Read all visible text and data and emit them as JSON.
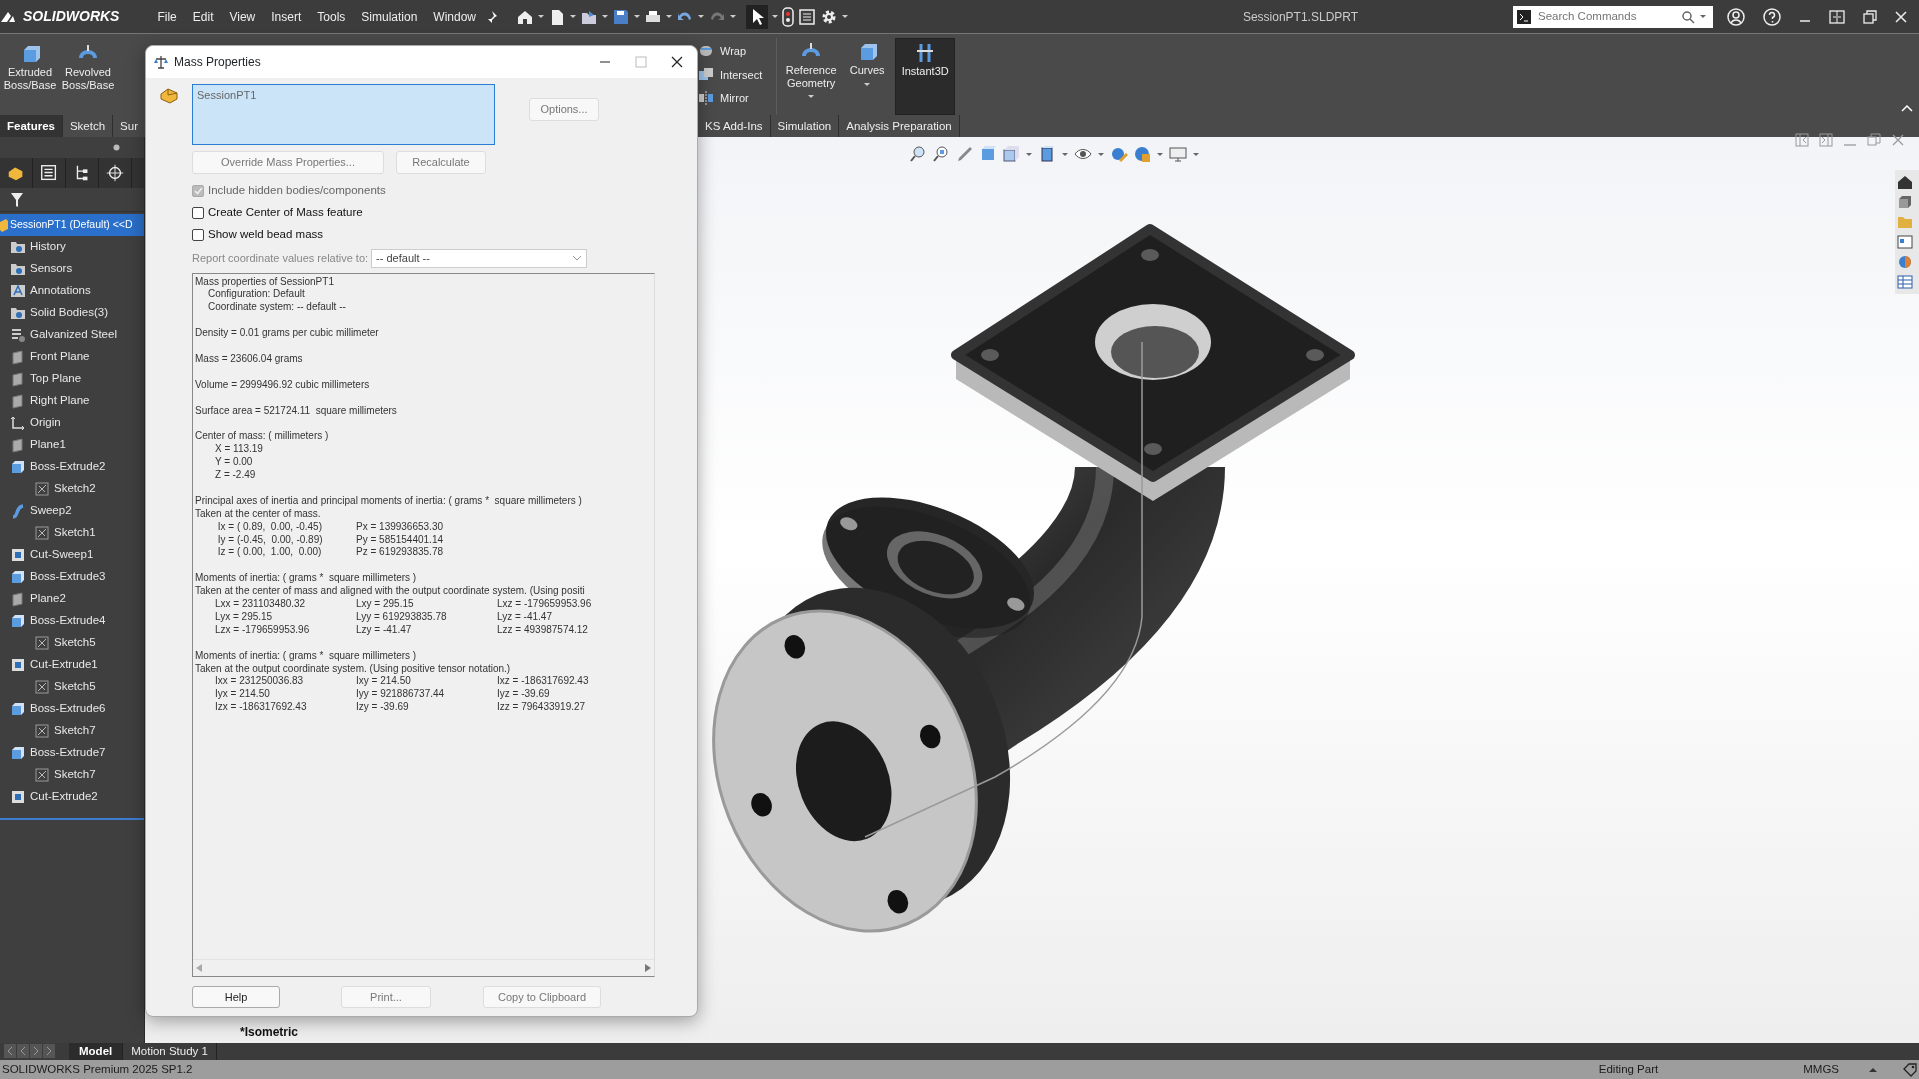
{
  "app": {
    "logo": "SOLIDWORKS",
    "menu": [
      "File",
      "Edit",
      "View",
      "Insert",
      "Tools",
      "Simulation",
      "Window"
    ],
    "document_title": "SessionPT1.SLDPRT",
    "search": {
      "placeholder": "Search Commands"
    }
  },
  "ribbon": {
    "left": [
      {
        "kind": "large",
        "label": "Extruded Boss/Base",
        "selected": false,
        "dropdown": false
      },
      {
        "kind": "large",
        "label": "Revolved Boss/Base",
        "selected": false,
        "dropdown": false
      }
    ],
    "right": [
      {
        "kind": "stack",
        "items": [
          {
            "label": "Wrap"
          },
          {
            "label": "Intersect"
          },
          {
            "label": "Mirror"
          }
        ]
      },
      {
        "kind": "large",
        "label": "Reference Geometry",
        "selected": false,
        "dropdown": true
      },
      {
        "kind": "large",
        "label": "Curves",
        "selected": false,
        "dropdown": true
      },
      {
        "kind": "large",
        "label": "Instant3D",
        "selected": true,
        "dropdown": false
      }
    ]
  },
  "command_tabs": {
    "left": [
      {
        "label": "Features",
        "selected": true
      },
      {
        "label": "Sketch",
        "selected": false
      },
      {
        "label": "Sur",
        "selected": false
      }
    ],
    "right": [
      {
        "label": "KS Add-Ins",
        "selected": false
      },
      {
        "label": "Simulation",
        "selected": false
      },
      {
        "label": "Analysis Preparation",
        "selected": false
      }
    ]
  },
  "feature_tree": {
    "label": "SessionPT1 (Default) <<D",
    "selected": true,
    "children": [
      {
        "kind": "folder",
        "label": "History",
        "selected": false
      },
      {
        "kind": "folder",
        "label": "Sensors",
        "selected": false
      },
      {
        "kind": "annotation",
        "label": "Annotations",
        "selected": false
      },
      {
        "kind": "folder",
        "label": "Solid Bodies(3)",
        "selected": false
      },
      {
        "kind": "material",
        "label": "Galvanized Steel",
        "selected": false
      },
      {
        "kind": "plane",
        "label": "Front Plane",
        "selected": false
      },
      {
        "kind": "plane",
        "label": "Top Plane",
        "selected": false
      },
      {
        "kind": "plane",
        "label": "Right Plane",
        "selected": false
      },
      {
        "kind": "origin",
        "label": "Origin",
        "selected": false
      },
      {
        "kind": "plane",
        "label": "Plane1",
        "selected": false
      },
      {
        "kind": "boss",
        "label": "Boss-Extrude2",
        "selected": false,
        "children": [
          {
            "kind": "sketch",
            "label": "Sketch2",
            "selected": false
          }
        ]
      },
      {
        "kind": "sweep",
        "label": "Sweep2",
        "selected": false,
        "children": [
          {
            "kind": "sketch",
            "label": "Sketch1",
            "selected": false
          }
        ]
      },
      {
        "kind": "cut",
        "label": "Cut-Sweep1",
        "selected": false
      },
      {
        "kind": "boss",
        "label": "Boss-Extrude3",
        "selected": false
      },
      {
        "kind": "plane",
        "label": "Plane2",
        "selected": false
      },
      {
        "kind": "boss",
        "label": "Boss-Extrude4",
        "selected": false,
        "children": [
          {
            "kind": "sketch",
            "label": "Sketch5",
            "selected": false
          }
        ]
      },
      {
        "kind": "cut",
        "label": "Cut-Extrude1",
        "selected": false,
        "children": [
          {
            "kind": "sketch",
            "label": "Sketch5",
            "selected": false
          }
        ]
      },
      {
        "kind": "boss",
        "label": "Boss-Extrude6",
        "selected": false,
        "children": [
          {
            "kind": "sketch",
            "label": "Sketch7",
            "selected": false
          }
        ]
      },
      {
        "kind": "boss",
        "label": "Boss-Extrude7",
        "selected": false,
        "children": [
          {
            "kind": "sketch",
            "label": "Sketch7",
            "selected": false
          }
        ]
      },
      {
        "kind": "cut",
        "label": "Cut-Extrude2",
        "selected": false
      }
    ]
  },
  "dialog": {
    "title": "Mass Properties",
    "selection": "SessionPT1",
    "buttons_top": [
      {
        "label": "Options...",
        "disabled": true
      }
    ],
    "buttons_mid": [
      {
        "label": "Override Mass Properties...",
        "disabled": true
      },
      {
        "label": "Recalculate",
        "disabled": true
      }
    ],
    "options": [
      {
        "label": "Include hidden bodies/components",
        "checked": true,
        "disabled": true
      },
      {
        "label": "Create Center of Mass feature",
        "checked": false,
        "disabled": false
      },
      {
        "label": "Show weld bead mass",
        "checked": false,
        "disabled": false
      }
    ],
    "coordinate_label": "Report coordinate values relative to:",
    "coordinate_value": "-- default --",
    "report": [
      [
        {
          "kind": "text",
          "cells": [
            "Mass properties of SessionPT1"
          ]
        },
        {
          "kind": "indent",
          "cells": [
            "Configuration: Default"
          ]
        },
        {
          "kind": "indent",
          "cells": [
            "Coordinate system: -- default --"
          ]
        }
      ],
      [
        {
          "kind": "text",
          "cells": [
            "Density = 0.01 grams per cubic millimeter"
          ]
        }
      ],
      [
        {
          "kind": "text",
          "cells": [
            "Mass = 23606.04 grams"
          ]
        }
      ],
      [
        {
          "kind": "text",
          "cells": [
            "Volume = 2999496.92 cubic millimeters"
          ]
        }
      ],
      [
        {
          "kind": "text",
          "cells": [
            "Surface area = 521724.11  square millimeters"
          ]
        }
      ],
      [
        {
          "kind": "text",
          "cells": [
            "Center of mass: ( millimeters )"
          ]
        },
        {
          "kind": "row",
          "cells": [
            "X = 113.19"
          ]
        },
        {
          "kind": "row",
          "cells": [
            "Y = 0.00"
          ]
        },
        {
          "kind": "row",
          "cells": [
            "Z = -2.49"
          ]
        }
      ],
      [
        {
          "kind": "text",
          "cells": [
            "Principal axes of inertia and principal moments of inertia: ( grams *  square millimeters )"
          ]
        },
        {
          "kind": "text",
          "cells": [
            "Taken at the center of mass."
          ]
        },
        {
          "kind": "row",
          "cells": [
            " Ix = ( 0.89,  0.00, -0.45)",
            "Px = 139936653.30"
          ]
        },
        {
          "kind": "row",
          "cells": [
            " Iy = (-0.45,  0.00, -0.89)",
            "Py = 585154401.14"
          ]
        },
        {
          "kind": "row",
          "cells": [
            " Iz = ( 0.00,  1.00,  0.00)",
            "Pz = 619293835.78"
          ]
        }
      ],
      [
        {
          "kind": "text",
          "cells": [
            "Moments of inertia: ( grams *  square millimeters )"
          ]
        },
        {
          "kind": "text",
          "cells": [
            "Taken at the center of mass and aligned with the output coordinate system. (Using positi"
          ]
        },
        {
          "kind": "row",
          "cells": [
            "Lxx = 231103480.32",
            "Lxy = 295.15",
            "Lxz = -179659953.96"
          ]
        },
        {
          "kind": "row",
          "cells": [
            "Lyx = 295.15",
            "Lyy = 619293835.78",
            "Lyz = -41.47"
          ]
        },
        {
          "kind": "row",
          "cells": [
            "Lzx = -179659953.96",
            "Lzy = -41.47",
            "Lzz = 493987574.12"
          ]
        }
      ],
      [
        {
          "kind": "text",
          "cells": [
            "Moments of inertia: ( grams *  square millimeters )"
          ]
        },
        {
          "kind": "text",
          "cells": [
            "Taken at the output coordinate system. (Using positive tensor notation.)"
          ]
        },
        {
          "kind": "row",
          "cells": [
            "Ixx = 231250036.83",
            "Ixy = 214.50",
            "Ixz = -186317692.43"
          ]
        },
        {
          "kind": "row",
          "cells": [
            "Iyx = 214.50",
            "Iyy = 921886737.44",
            "Iyz = -39.69"
          ]
        },
        {
          "kind": "row",
          "cells": [
            "Izx = -186317692.43",
            "Izy = -39.69",
            "Izz = 796433919.27"
          ]
        }
      ]
    ],
    "buttons_bottom": [
      {
        "label": "Help",
        "disabled": false
      },
      {
        "label": "Print...",
        "disabled": true
      },
      {
        "label": "Copy to Clipboard",
        "disabled": true
      }
    ]
  },
  "viewport": {
    "view_label": "*Isometric"
  },
  "bottom_tabs": [
    {
      "label": "Model",
      "selected": true
    },
    {
      "label": "Motion Study 1",
      "selected": false
    }
  ],
  "status_bar": {
    "product": "SOLIDWORKS Premium 2025 SP1.2",
    "mode": "Editing Part",
    "units": "MMGS"
  }
}
